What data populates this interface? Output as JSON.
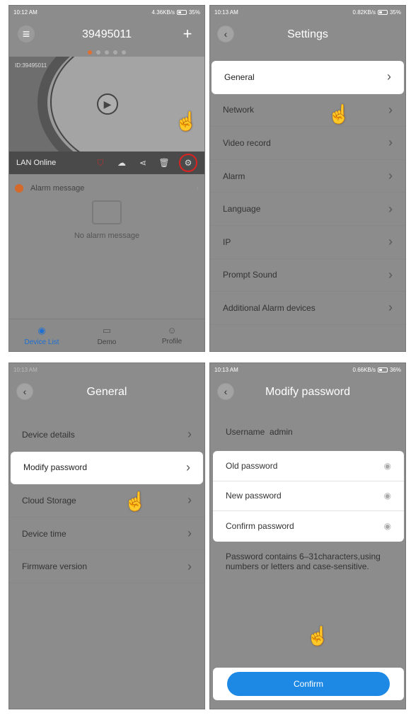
{
  "panel1": {
    "status": {
      "time": "10:12 AM",
      "right": "4.36KB/s",
      "battery": "35%"
    },
    "title": "39495011",
    "video": {
      "device_id": "ID:39495011",
      "connection": "LAN Online"
    },
    "alarm_label": "Alarm message",
    "no_alarm": "No alarm message",
    "tabs": [
      {
        "label": "Device List",
        "icon": "camera-icon"
      },
      {
        "label": "Demo",
        "icon": "video-icon"
      },
      {
        "label": "Profile",
        "icon": "person-icon"
      }
    ]
  },
  "panel2": {
    "status": {
      "time": "10:13 AM",
      "right": "0.82KB/s",
      "battery": "35%"
    },
    "title": "Settings",
    "items": [
      "General",
      "Network",
      "Video record",
      "Alarm",
      "Language",
      "IP",
      "Prompt Sound",
      "Additional Alarm devices"
    ]
  },
  "panel3": {
    "status": {
      "time": "10:13 AM",
      "right": "",
      "battery": ""
    },
    "title": "General",
    "items": [
      "Device details",
      "Modify password",
      "Cloud Storage",
      "Device time",
      "Firmware version"
    ]
  },
  "panel4": {
    "status": {
      "time": "10:13 AM",
      "right": "0.66KB/s",
      "battery": "36%"
    },
    "title": "Modify password",
    "username_label": "Username",
    "username_value": "admin",
    "fields": [
      "Old password",
      "New password",
      "Confirm password"
    ],
    "hint": "Password contains 6–31characters,using numbers or letters and case-sensitive.",
    "confirm_label": "Confirm"
  },
  "colors": {
    "accent": "#1e88e5",
    "tab_active": "#1e6fd0",
    "alarm_dot": "#d36a2c",
    "highlight": "#ffffff"
  }
}
